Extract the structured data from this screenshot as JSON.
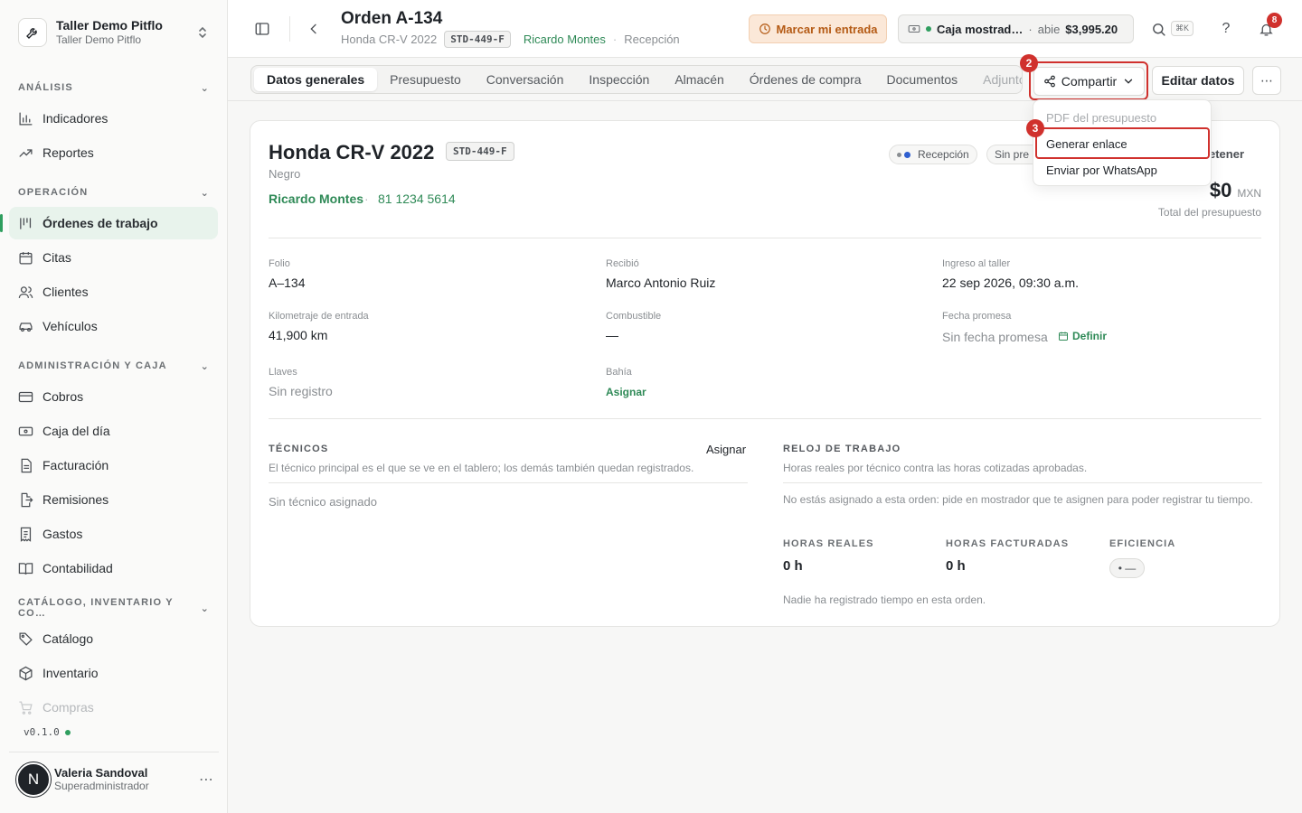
{
  "org": {
    "name": "Taller Demo Pitflo",
    "sub": "Taller Demo Pitflo"
  },
  "sidebar": {
    "sections": [
      {
        "label": "ANÁLISIS"
      },
      {
        "label": "OPERACIÓN"
      },
      {
        "label": "ADMINISTRACIÓN Y CAJA"
      },
      {
        "label": "CATÁLOGO, INVENTARIO Y CO…"
      }
    ],
    "items": [
      {
        "label": "Indicadores",
        "icon": "bar-chart-icon"
      },
      {
        "label": "Reportes",
        "icon": "trending-up-icon"
      },
      {
        "label": "Órdenes de trabajo",
        "icon": "kanban-icon",
        "active": true
      },
      {
        "label": "Citas",
        "icon": "calendar-icon"
      },
      {
        "label": "Clientes",
        "icon": "users-icon"
      },
      {
        "label": "Vehículos",
        "icon": "car-icon"
      },
      {
        "label": "Cobros",
        "icon": "credit-card-icon"
      },
      {
        "label": "Caja del día",
        "icon": "cash-register-icon"
      },
      {
        "label": "Facturación",
        "icon": "file-icon"
      },
      {
        "label": "Remisiones",
        "icon": "file-export-icon"
      },
      {
        "label": "Gastos",
        "icon": "receipt-icon"
      },
      {
        "label": "Contabilidad",
        "icon": "book-icon"
      },
      {
        "label": "Catálogo",
        "icon": "tag-icon"
      },
      {
        "label": "Inventario",
        "icon": "box-icon"
      },
      {
        "label": "Compras",
        "icon": "cart-icon"
      }
    ],
    "version": "v0.1.0"
  },
  "user": {
    "initial": "N",
    "name": "Valeria Sandoval",
    "role": "Superadministrador"
  },
  "header": {
    "title": "Orden A-134",
    "vehicle": "Honda CR-V 2022",
    "plate": "STD-449-F",
    "client": "Ricardo Montes",
    "stage": "Recepción",
    "entry_button": "Marcar mi entrada",
    "cash": {
      "name": "Caja mostrad…",
      "status": "abie",
      "amount": "$3,995.20"
    },
    "shortcut": "⌘K",
    "help": "?",
    "notifications": "8"
  },
  "tabs": [
    "Datos generales",
    "Presupuesto",
    "Conversación",
    "Inspección",
    "Almacén",
    "Órdenes de compra",
    "Documentos",
    "Adjuntos"
  ],
  "toolbar": {
    "share_label": "Compartir",
    "edit_label": "Editar datos"
  },
  "annotations": {
    "share_step": "2",
    "generate_step": "3"
  },
  "share_menu": [
    "PDF del presupuesto",
    "Generar enlace",
    "Enviar por WhatsApp"
  ],
  "vehicle_card": {
    "title": "Honda CR-V 2022",
    "plate": "STD-449-F",
    "color": "Negro",
    "client": "Ricardo Montes",
    "phone": "81 1234 5614",
    "status_pill": "Recepción",
    "second_pill": "Sin pre",
    "retain_label": "etener",
    "total": "$0",
    "currency": "MXN",
    "total_label": "Total del presupuesto"
  },
  "fields": {
    "folio": {
      "label": "Folio",
      "value": "A–134"
    },
    "received": {
      "label": "Recibió",
      "value": "Marco Antonio Ruiz"
    },
    "intake": {
      "label": "Ingreso al taller",
      "value": "22 sep 2026, 09:30 a.m."
    },
    "mileage": {
      "label": "Kilometraje de entrada",
      "value": "41,900 km"
    },
    "fuel": {
      "label": "Combustible",
      "value": "—"
    },
    "promise": {
      "label": "Fecha promesa",
      "value": "Sin fecha promesa",
      "action": "Definir"
    },
    "keys": {
      "label": "Llaves",
      "value": "Sin registro"
    },
    "bay": {
      "label": "Bahía",
      "action": "Asignar"
    }
  },
  "technicians": {
    "caption": "TÉCNICOS",
    "assign": "Asignar",
    "description": "El técnico principal es el que se ve en el tablero; los demás también quedan registrados.",
    "empty": "Sin técnico asignado"
  },
  "work_clock": {
    "caption": "RELOJ DE TRABAJO",
    "description": "Horas reales por técnico contra las horas cotizadas aprobadas.",
    "notice": "No estás asignado a esta orden: pide en mostrador que te asignen para poder registrar tu tiempo.",
    "real_label": "HORAS REALES",
    "real_value": "0 h",
    "billed_label": "HORAS FACTURADAS",
    "billed_value": "0 h",
    "efficiency_label": "EFICIENCIA",
    "efficiency_value": "• —",
    "empty": "Nadie ha registrado tiempo en esta orden."
  },
  "colors": {
    "accent_green": "#2f8a57",
    "highlight_red": "#d0312d",
    "entry_orange": "#b45a14"
  }
}
